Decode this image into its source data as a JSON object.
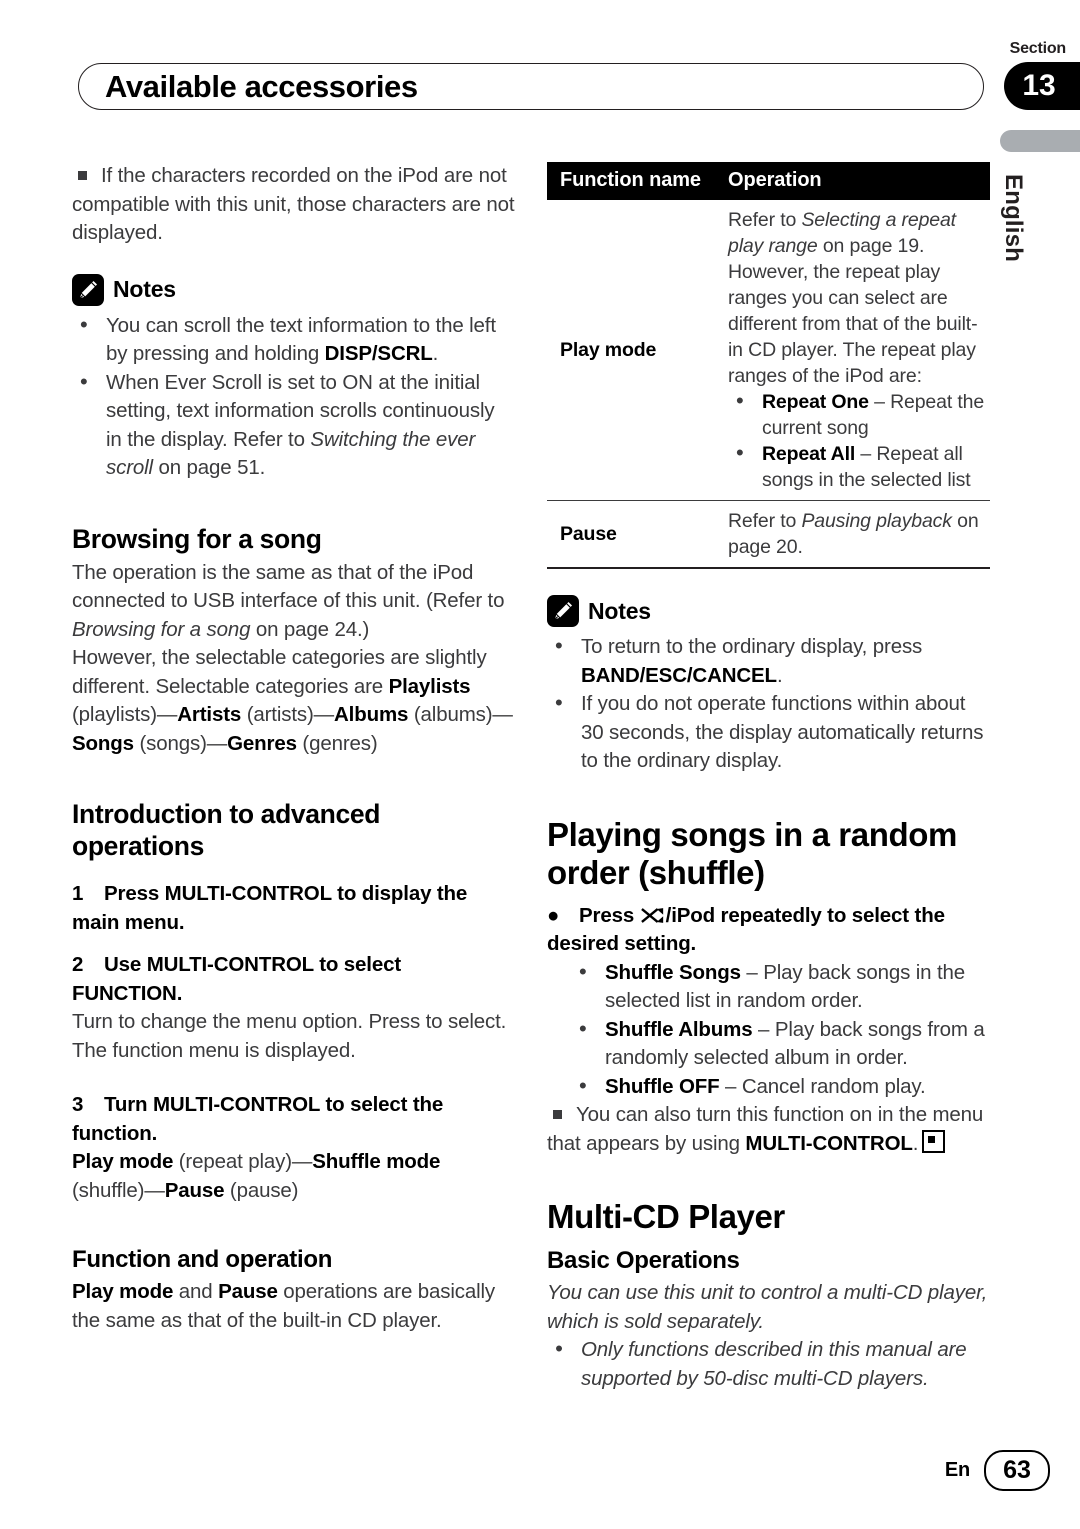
{
  "header": {
    "section_label": "Section",
    "section_number": "13",
    "title": "Available accessories"
  },
  "margin": {
    "language": "English"
  },
  "left_column": {
    "intro_note": {
      "marker": "square-bullet",
      "text": "If the characters recorded on the iPod are not compatible with this unit, those characters are not displayed."
    },
    "notes": {
      "icon": "pencil-icon",
      "label": "Notes",
      "items": [
        {
          "part1": "You can scroll the text information to the left by pressing and holding ",
          "bold": "DISP/SCRL",
          "part2": "."
        },
        {
          "part1": "When Ever Scroll is set to ON at the initial setting, text information scrolls continuously in the display. Refer to ",
          "italic": "Switching the ever scroll",
          "part2": " on page 51."
        }
      ]
    },
    "browsing": {
      "heading": "Browsing for a song",
      "p1_a": "The operation is the same as that of the iPod connected to USB interface of this unit. (Refer to ",
      "p1_italic": "Browsing for a song",
      "p1_b": " on page 24.)",
      "p2": "However, the selectable categories are slightly different. Selectable categories are ",
      "cat1": "Playlists",
      "cat1_paren": " (playlists)—",
      "cat2": "Artists",
      "cat2_paren": " (artists)—",
      "cat3": "Albums",
      "cat3_paren": " (albums)—",
      "cat4": "Songs",
      "cat4_paren": " (songs)—",
      "cat5": "Genres",
      "cat5_paren": " (genres)"
    },
    "advanced": {
      "heading": "Introduction to advanced operations",
      "step1_num": "1",
      "step1_text": "Press MULTI-CONTROL to display the main menu.",
      "step2_num": "2",
      "step2_text": "Use MULTI-CONTROL to select FUNCTION.",
      "step2_body1": "Turn to change the menu option. Press to select.",
      "step2_body2": "The function menu is displayed.",
      "step3_num": "3",
      "step3_text": "Turn MULTI-CONTROL to select the function.",
      "step3_mode1": "Play mode",
      "step3_mode1_paren": " (repeat play)—",
      "step3_mode2": "Shuffle mode",
      "step3_mode2_paren": " (shuffle)—",
      "step3_mode3": "Pause",
      "step3_mode3_paren": " (pause)"
    },
    "function_operation": {
      "heading": "Function and operation",
      "b1": "Play mode",
      "mid": " and ",
      "b2": "Pause",
      "rest": " operations are basically the same as that of the built-in CD player."
    }
  },
  "right_column": {
    "table": {
      "headers": [
        "Function name",
        "Operation"
      ],
      "rows": [
        {
          "name": "Play mode",
          "op_a": "Refer to ",
          "op_italic": "Selecting a repeat play range",
          "op_b": " on page 19.",
          "op_c": "However, the repeat play ranges you can select are different from that of the built-in CD player. The repeat play ranges of the iPod are:",
          "bullets": [
            {
              "bold": "Repeat One",
              "rest": " – Repeat the current song"
            },
            {
              "bold": "Repeat All",
              "rest": " – Repeat all songs in the selected list"
            }
          ]
        },
        {
          "name": "Pause",
          "op_a": "Refer to ",
          "op_italic": "Pausing playback",
          "op_b": " on page 20.",
          "op_c": "",
          "bullets": []
        }
      ]
    },
    "notes": {
      "icon": "pencil-icon",
      "label": "Notes",
      "items": [
        {
          "part1": "To return to the ordinary display, press ",
          "bold": "BAND/ESC/CANCEL",
          "part2": "."
        },
        {
          "part1": "If you do not operate functions within about 30 seconds, the display automatically returns to the ordinary display.",
          "bold": "",
          "part2": ""
        }
      ]
    },
    "shuffle": {
      "heading": "Playing songs in a random order (shuffle)",
      "bullet_marker": "filled-circle",
      "instruction_a": "Press ",
      "instruction_icon": "shuffle-icon",
      "instruction_b": "/iPod repeatedly to select the desired setting.",
      "options": [
        {
          "bold": "Shuffle Songs",
          "rest": " – Play back songs in the selected list in random order."
        },
        {
          "bold": "Shuffle Albums",
          "rest": " – Play back songs from a randomly selected album in order."
        },
        {
          "bold": "Shuffle OFF",
          "rest": " – Cancel random play."
        }
      ],
      "note_a": "You can also turn this function on in the menu that appears by using ",
      "note_bold": "MULTI-CONTROL",
      "note_b": ".",
      "endmark": "square-end-icon"
    },
    "multicd": {
      "heading": "Multi-CD Player",
      "subheading": "Basic Operations",
      "intro": "You can use this unit to control a multi-CD player, which is sold separately.",
      "bullet": "Only functions described in this manual are supported by 50-disc multi-CD players."
    }
  },
  "footer": {
    "lang": "En",
    "page": "63"
  }
}
